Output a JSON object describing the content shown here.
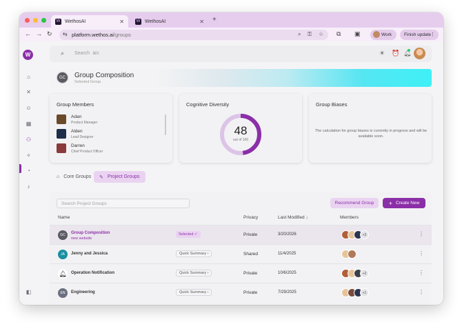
{
  "browser": {
    "tabs": [
      {
        "label": "WethosAI"
      },
      {
        "label": "WethosAI"
      }
    ],
    "new_tab": "+",
    "url_host": "platform.wethos.ai",
    "url_path": "/groups",
    "profile_label": "Work",
    "finish_update_label": "Finish update"
  },
  "sidebar": {
    "logo_text": "W"
  },
  "topbar": {
    "search_placeholder": "Search",
    "search_shortcut": "⌘K"
  },
  "banner": {
    "avatar_initials": "GC",
    "title": "Group Composition",
    "subtitle": "Selected Group"
  },
  "members_card": {
    "title": "Group Members",
    "members": [
      {
        "name": "Adan",
        "role": "Product Manager",
        "color": "#6b4a2a"
      },
      {
        "name": "Alden",
        "role": "Lead Designer",
        "color": "#1e2e4a"
      },
      {
        "name": "Darren",
        "role": "Chief Product Officer",
        "color": "#8a3a3a"
      }
    ]
  },
  "diversity_card": {
    "title": "Cognitive Diversity",
    "value": "48",
    "max_label": "out of 100",
    "fraction": 0.48,
    "accent": "#8b2fa8",
    "track": "#dcc4e6"
  },
  "biases_card": {
    "title": "Group Biases",
    "message": "The calculation for group biases is currently in progress and will be available soon."
  },
  "group_tabs": [
    {
      "label": "Core Groups",
      "active": false
    },
    {
      "label": "Project Groups",
      "active": true
    }
  ],
  "panel": {
    "search_placeholder": "Search Project Groups",
    "recommend_label": "Recommend Group",
    "create_label": "Create New",
    "columns": {
      "name": "Name",
      "privacy": "Privacy",
      "modified": "Last Modified ↓",
      "members": "Members"
    },
    "rows": [
      {
        "initials": "GC",
        "avatar_color": "#5a5a62",
        "name": "Group Composition",
        "sub": "new website",
        "badge": "Selected ✓",
        "selected": true,
        "privacy": "Private",
        "modified": "3/20/2026",
        "more": "+3"
      },
      {
        "initials": "JA",
        "avatar_color": "#1a8fa0",
        "name": "Jenny and Jessica",
        "sub": "",
        "badge": "Quick Summary ›",
        "selected": false,
        "privacy": "Shared",
        "modified": "11/4/2025",
        "more": ""
      },
      {
        "initials": "",
        "avatar_color": "#222",
        "name": "Operation Notification",
        "sub": "",
        "badge": "Quick Summary ›",
        "selected": false,
        "privacy": "Private",
        "modified": "10/6/2025",
        "more": "+2"
      },
      {
        "initials": "EN",
        "avatar_color": "#6a7080",
        "name": "Engineering",
        "sub": "",
        "badge": "Quick Summary ›",
        "selected": false,
        "privacy": "Private",
        "modified": "7/29/2025",
        "more": "+1"
      }
    ]
  }
}
